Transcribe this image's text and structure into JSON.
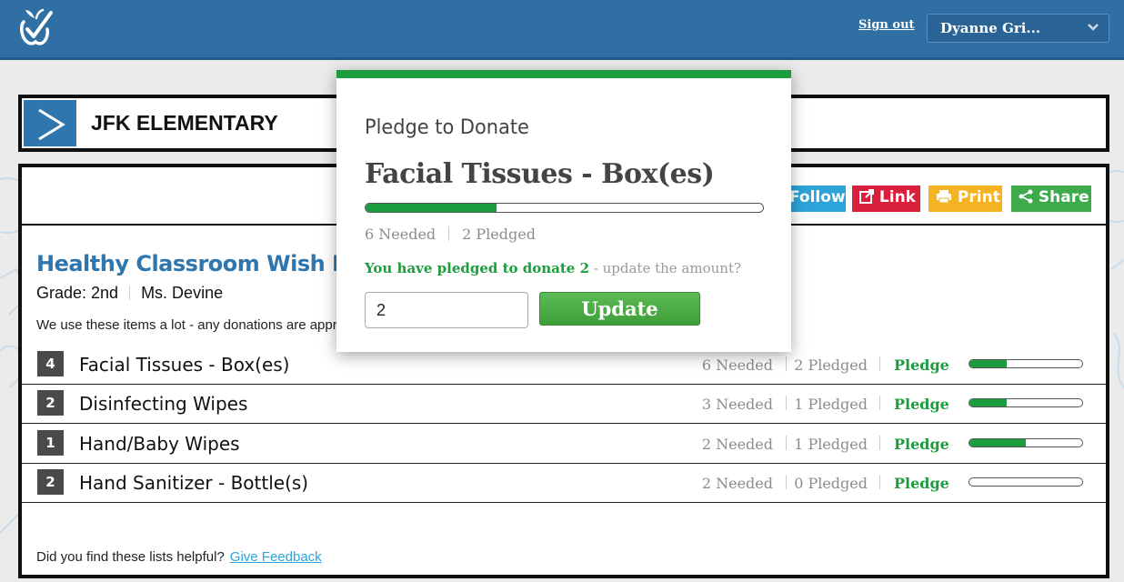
{
  "header": {
    "sign_out": "Sign out",
    "user_name": "Dyanne Gri..."
  },
  "school": {
    "name": "JFK ELEMENTARY"
  },
  "share_buttons": {
    "follow": "Follow",
    "link": "Link",
    "print": "Print",
    "share": "Share"
  },
  "wishlist": {
    "title": "Healthy Classroom Wish List",
    "grade": "Grade: 2nd",
    "teacher": "Ms. Devine",
    "description": "We use these items a lot - any donations are appreciated!",
    "items": [
      {
        "qty": "4",
        "name": "Facial Tissues - Box(es)",
        "needed": "6 Needed",
        "pledged": "2 Pledged",
        "action": "Pledge",
        "progress": 0.33
      },
      {
        "qty": "2",
        "name": "Disinfecting Wipes",
        "needed": "3 Needed",
        "pledged": "1 Pledged",
        "action": "Pledge",
        "progress": 0.33
      },
      {
        "qty": "1",
        "name": "Hand/Baby Wipes",
        "needed": "2 Needed",
        "pledged": "1 Pledged",
        "action": "Pledge",
        "progress": 0.5
      },
      {
        "qty": "2",
        "name": "Hand Sanitizer - Bottle(s)",
        "needed": "2 Needed",
        "pledged": "0 Pledged",
        "action": "Pledge",
        "progress": 0.0
      }
    ]
  },
  "footer": {
    "question": "Did you find these lists helpful?",
    "feedback_link": "Give Feedback"
  },
  "modal": {
    "heading": "Pledge to Donate",
    "item_name": "Facial Tissues - Box(es)",
    "needed": "6 Needed",
    "pledged": "2 Pledged",
    "progress": 0.33,
    "message_green": "You have pledged to donate 2",
    "message_grey": " - update the amount?",
    "amount_value": "2",
    "update_label": "Update"
  },
  "colors": {
    "header_blue": "#2f6fa3",
    "accent_green": "#1b9d3d",
    "title_blue": "#2e76ad"
  }
}
